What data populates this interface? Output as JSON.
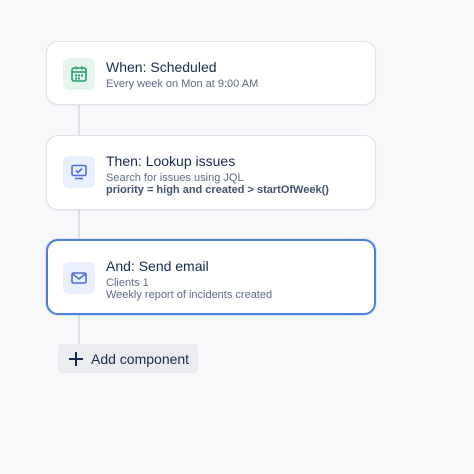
{
  "steps": [
    {
      "title": "When: Scheduled",
      "lines": [
        "Every week on Mon at 9:00 AM"
      ],
      "icon": "calendar-icon",
      "accent": "#22a06b"
    },
    {
      "title": "Then: Lookup issues",
      "lines": [
        "Search for issues using JQL"
      ],
      "code": "priority = high and created > startOfWeek()",
      "icon": "monitor-check-icon",
      "accent": "#4c6ed6"
    },
    {
      "title": "And: Send email",
      "lines": [
        "Clients 1",
        "Weekly report of incidents created"
      ],
      "icon": "envelope-icon",
      "accent": "#4c6ed6",
      "selected": true
    }
  ],
  "add_component": {
    "label": "Add component",
    "icon": "plus-icon"
  },
  "colors": {
    "selected_border": "#4c7fd6",
    "card_border": "#dfe1e6",
    "connector": "#dcdfe4"
  }
}
